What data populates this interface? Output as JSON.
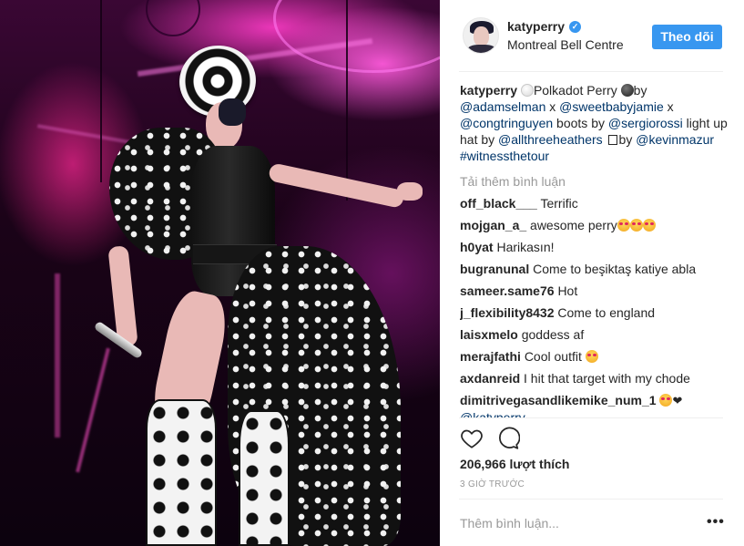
{
  "post": {
    "username": "katyperry",
    "location": "Montreal Bell Centre",
    "follow_label": "Theo dõi"
  },
  "caption": {
    "username": "katyperry",
    "part1": "Polkadot Perry",
    "part2": "by",
    "mention_adamselman": "@adamselman",
    "x1": " x ",
    "mention_sweetbabyjamie": "@sweetbabyjamie",
    "x2": " x ",
    "mention_congtringuyen": "@congtringuyen",
    "boots_by": " boots by ",
    "mention_sergiorossi": "@sergiorossi",
    "light_up_hat_by": " light up hat by ",
    "mention_allthreeheathers": "@allthreeheathers",
    "by": "by",
    "mention_kevinmazur": "@kevinmazur",
    "hashtag": "#witnessthetour"
  },
  "load_more": "Tải thêm bình luận",
  "comments": [
    {
      "user": "off_black___",
      "text": "Terrific"
    },
    {
      "user": "mojgan_a_",
      "text": "awesome perry"
    },
    {
      "user": "h0yat",
      "text": "Harikasın!"
    },
    {
      "user": "bugranunal",
      "text": "Come to beşiktaş katiye abla"
    },
    {
      "user": "sameer.same76",
      "text": "Hot"
    },
    {
      "user": "j_flexibility8432",
      "text": "Come to england"
    },
    {
      "user": "laisxmelo",
      "text": "goddess af"
    },
    {
      "user": "merajfathi",
      "text": "Cool outfit"
    },
    {
      "user": "axdanreid",
      "text": "I hit that target with my chode"
    },
    {
      "user": "dimitrivegasandlikemike_num_1",
      "text": "",
      "mention": "@katyperry"
    }
  ],
  "heart_glyph": "❤",
  "likes": "206,966 lượt thích",
  "timestamp": "3 GIỜ TRƯỚC",
  "add_comment_placeholder": "Thêm bình luận...",
  "more_options": "•••",
  "icons": {
    "like": "heart-outline-icon",
    "comment": "speech-bubble-icon",
    "verified": "verified-badge-icon"
  },
  "colors": {
    "accent": "#3897f0",
    "link": "#003569",
    "muted": "#999999",
    "text": "#262626"
  }
}
